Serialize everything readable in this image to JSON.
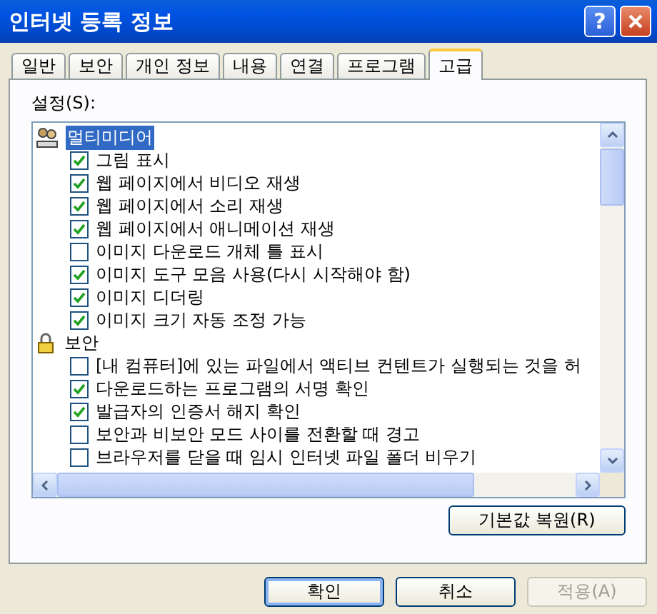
{
  "window": {
    "title": "인터넷 등록 정보",
    "help_label": "?"
  },
  "tabs": [
    {
      "label": "일반",
      "selected": false
    },
    {
      "label": "보안",
      "selected": false
    },
    {
      "label": "개인 정보",
      "selected": false
    },
    {
      "label": "내용",
      "selected": false
    },
    {
      "label": "연결",
      "selected": false
    },
    {
      "label": "프로그램",
      "selected": false
    },
    {
      "label": "고급",
      "selected": true
    }
  ],
  "settings_label": "설정(S):",
  "settings": [
    {
      "kind": "multimedia",
      "label": "멀티미디어",
      "selected": true,
      "children": [
        {
          "label": "그림 표시",
          "checked": true
        },
        {
          "label": "웹 페이지에서 비디오 재생",
          "checked": true
        },
        {
          "label": "웹 페이지에서 소리 재생",
          "checked": true
        },
        {
          "label": "웹 페이지에서 애니메이션 재생",
          "checked": true
        },
        {
          "label": "이미지 다운로드 개체 틀 표시",
          "checked": false
        },
        {
          "label": "이미지 도구 모음 사용(다시 시작해야 함)",
          "checked": true
        },
        {
          "label": "이미지 디더링",
          "checked": true
        },
        {
          "label": "이미지 크기 자동 조정 가능",
          "checked": true
        }
      ]
    },
    {
      "kind": "security",
      "label": "보안",
      "selected": false,
      "children": [
        {
          "label": "[내 컴퓨터]에 있는 파일에서 액티브 컨텐트가 실행되는 것을 허",
          "checked": false
        },
        {
          "label": "다운로드하는 프로그램의 서명 확인",
          "checked": true
        },
        {
          "label": "발급자의 인증서 해지 확인",
          "checked": true
        },
        {
          "label": "보안과 비보안 모드 사이를 전환할 때 경고",
          "checked": false
        },
        {
          "label": "브라우저를 닫을 때 임시 인터넷 파일 폴더 비우기",
          "checked": false
        }
      ]
    }
  ],
  "restore_button": "기본값 복원(R)",
  "buttons": [
    {
      "label": "확인",
      "disabled": false,
      "default": true
    },
    {
      "label": "취소",
      "disabled": false,
      "default": false
    },
    {
      "label": "적용(A)",
      "disabled": true,
      "default": false
    }
  ]
}
